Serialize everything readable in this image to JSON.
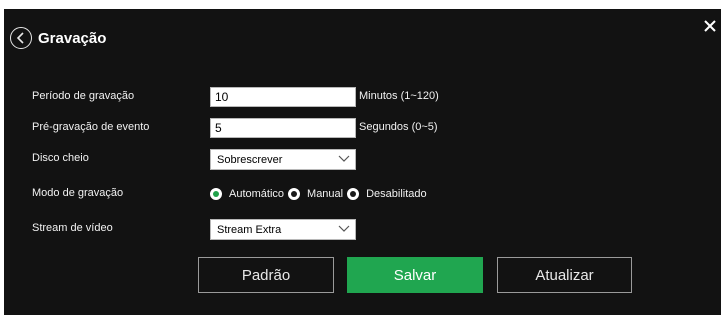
{
  "header": {
    "title": "Gravação"
  },
  "form": {
    "recording_period": {
      "label": "Período de gravação",
      "value": "10",
      "unit": "Minutos (1~120)"
    },
    "pre_recording": {
      "label": "Pré-gravação de evento",
      "value": "5",
      "unit": "Segundos (0~5)"
    },
    "disk_full": {
      "label": "Disco cheio",
      "selected": "Sobrescrever"
    },
    "recording_mode": {
      "label": "Modo de gravação",
      "options": [
        {
          "label": "Automático",
          "selected": true
        },
        {
          "label": "Manual",
          "selected": false
        },
        {
          "label": "Desabilitado",
          "selected": false
        }
      ]
    },
    "video_stream": {
      "label": "Stream de vídeo",
      "selected": "Stream Extra"
    }
  },
  "buttons": {
    "default_label": "Padrão",
    "save_label": "Salvar",
    "refresh_label": "Atualizar"
  },
  "colors": {
    "panel_bg": "#121212",
    "accent_green": "#20a650"
  },
  "icons": {
    "back": "circle-chevron-left-icon",
    "close": "close-icon",
    "dropdown": "chevron-down-icon"
  }
}
